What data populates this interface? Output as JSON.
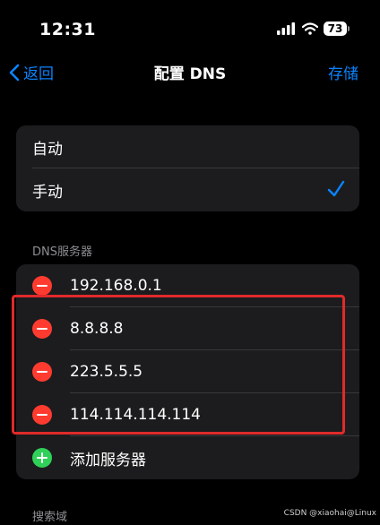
{
  "status_bar": {
    "time": "12:31",
    "battery": "73"
  },
  "nav": {
    "back_label": "返回",
    "title": "配置 DNS",
    "save_label": "存储"
  },
  "mode": {
    "options": [
      {
        "label": "自动",
        "selected": false
      },
      {
        "label": "手动",
        "selected": true
      }
    ]
  },
  "dns": {
    "header": "DNS服务器",
    "servers": [
      "192.168.0.1",
      "8.8.8.8",
      "223.5.5.5",
      "114.114.114.114"
    ],
    "add_label": "添加服务器"
  },
  "search_domains": {
    "header": "搜索域"
  },
  "watermark": "CSDN @xiaohai@Linux",
  "colors": {
    "accent": "#0a84ff",
    "delete": "#ff3b30",
    "add": "#30d158",
    "highlight_border": "#e02a2a"
  }
}
